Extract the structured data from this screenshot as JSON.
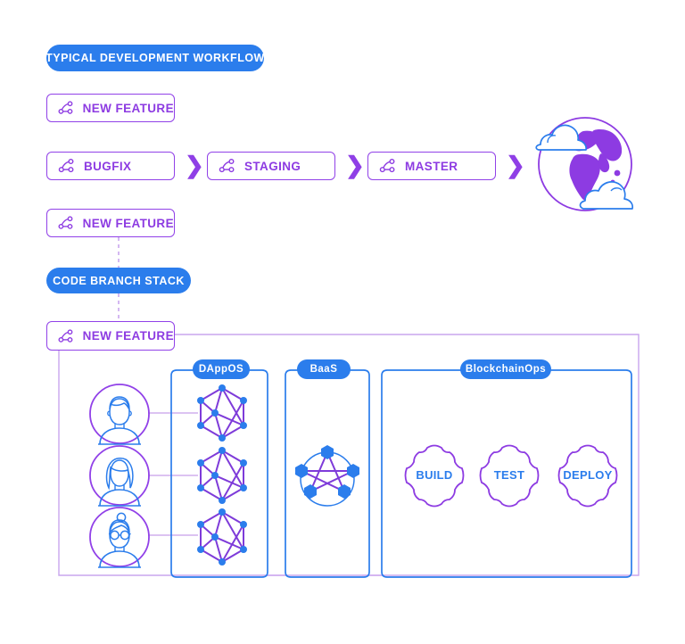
{
  "diagram": {
    "title_pill": {
      "label": "TYPICAL DEVELOPMENT WORKFLOW"
    },
    "stack_pill": {
      "label": "CODE BRANCH STACK"
    },
    "workflow_branches": [
      {
        "label": "NEW FEATURE",
        "icon": "git-branch-icon"
      },
      {
        "label": "BUGFIX",
        "icon": "git-branch-icon"
      },
      {
        "label": "STAGING",
        "icon": "git-branch-icon"
      },
      {
        "label": "MASTER",
        "icon": "git-branch-icon"
      },
      {
        "label": "NEW FEATURE",
        "icon": "git-branch-icon"
      }
    ],
    "stack_branch": {
      "label": "NEW FEATURE",
      "icon": "git-branch-icon"
    },
    "arrows": [
      "chevron-right-icon",
      "chevron-right-icon",
      "chevron-right-icon"
    ],
    "globe": {
      "icon": "globe-cloud-icon"
    },
    "panels": [
      {
        "label": "DAppOS",
        "icon": "hexagon-network-icon"
      },
      {
        "label": "BaaS",
        "icon": "pentagon-network-icon"
      },
      {
        "label": "BlockchainOps",
        "icon": "gear-icon"
      }
    ],
    "avatars": [
      {
        "name": "avatar-developer-1",
        "icon": "user-short-hair-icon"
      },
      {
        "name": "avatar-developer-2",
        "icon": "user-long-hair-icon"
      },
      {
        "name": "avatar-developer-3",
        "icon": "user-glasses-icon"
      }
    ],
    "ops_stages": [
      {
        "label": "BUILD",
        "icon": "gear-icon"
      },
      {
        "label": "TEST",
        "icon": "gear-icon"
      },
      {
        "label": "DEPLOY",
        "icon": "gear-icon"
      }
    ],
    "colors": {
      "blue": "#2B7DEC",
      "purple": "#8D3BE2",
      "purple_light": "#9141E8",
      "white": "#FFFFFF"
    }
  }
}
